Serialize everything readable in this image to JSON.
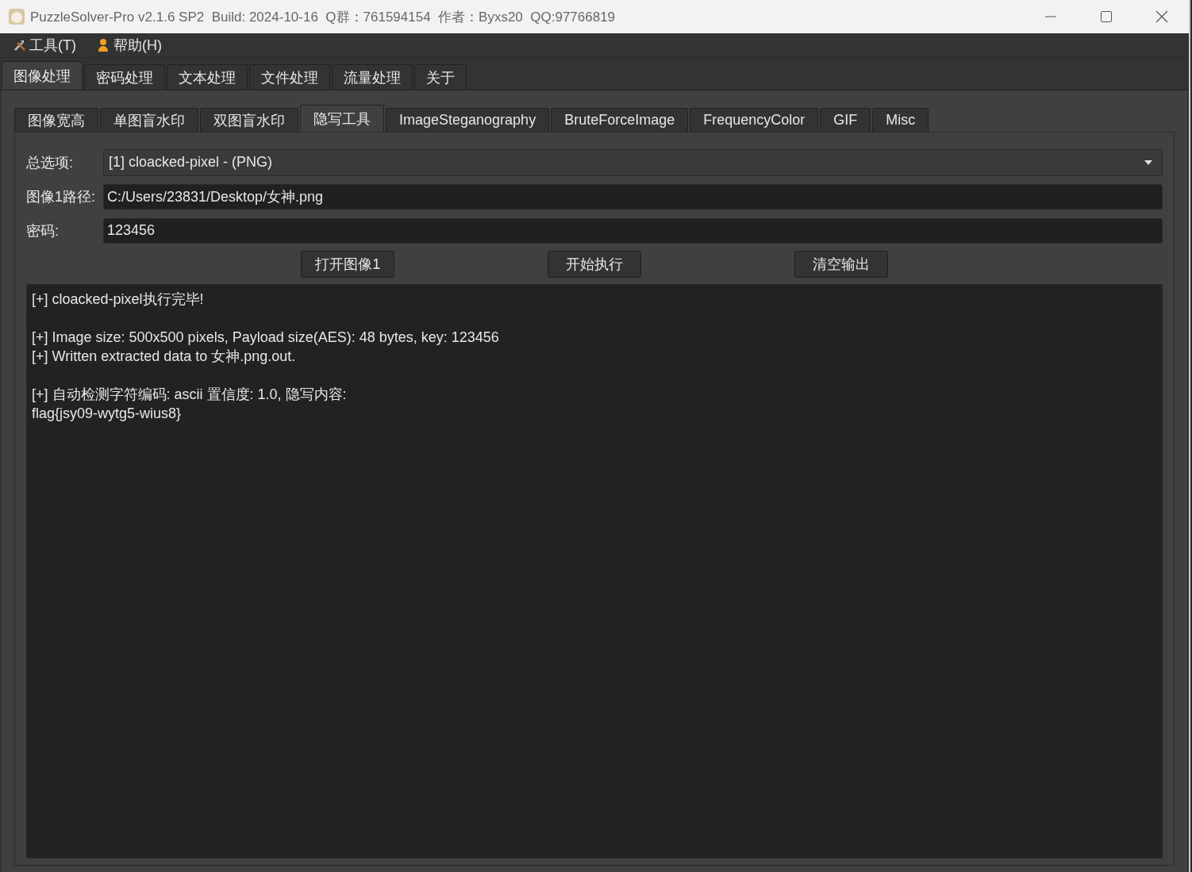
{
  "window": {
    "title": "PuzzleSolver-Pro v2.1.6 SP2  Build: 2024-10-16  Q群：761594154  作者：Byxs20  QQ:97766819"
  },
  "menu": [
    {
      "label": "工具(T)",
      "kind": "tools"
    },
    {
      "label": "帮助(H)",
      "kind": "help"
    }
  ],
  "tabs": [
    {
      "label": "图像处理",
      "selected": true
    },
    {
      "label": "密码处理",
      "selected": false
    },
    {
      "label": "文本处理",
      "selected": false
    },
    {
      "label": "文件处理",
      "selected": false
    },
    {
      "label": "流量处理",
      "selected": false
    },
    {
      "label": "关于",
      "selected": false
    }
  ],
  "subtabs": [
    {
      "label": "图像宽高",
      "selected": false
    },
    {
      "label": "单图盲水印",
      "selected": false
    },
    {
      "label": "双图盲水印",
      "selected": false
    },
    {
      "label": "隐写工具",
      "selected": true
    },
    {
      "label": "ImageSteganography",
      "selected": false
    },
    {
      "label": "BruteForceImage",
      "selected": false
    },
    {
      "label": "FrequencyColor",
      "selected": false
    },
    {
      "label": "GIF",
      "selected": false
    },
    {
      "label": "Misc",
      "selected": false
    }
  ],
  "form": [
    {
      "label": "总选项:",
      "kind": "dropdown",
      "value": "[1] cloacked-pixel - (PNG)"
    },
    {
      "label": "图像1路径:",
      "kind": "input",
      "value": "C:/Users/23831/Desktop/女神.png"
    },
    {
      "label": "密码:",
      "kind": "input",
      "value": "123456"
    }
  ],
  "buttons": [
    "打开图像1",
    "开始执行",
    "清空输出"
  ],
  "output": [
    {
      "lines": [
        "[+] cloacked-pixel执行完毕!"
      ]
    },
    {
      "lines": [
        "[+] Image size: 500x500 pixels, Payload size(AES): 48 bytes, key: 123456",
        "[+] Written extracted data to 女神.png.out."
      ]
    },
    {
      "lines": [
        "[+] 自动检测字符编码: ascii 置信度: 1.0, 隐写内容:",
        "flag{jsy09-wytg5-wius8}"
      ]
    }
  ]
}
